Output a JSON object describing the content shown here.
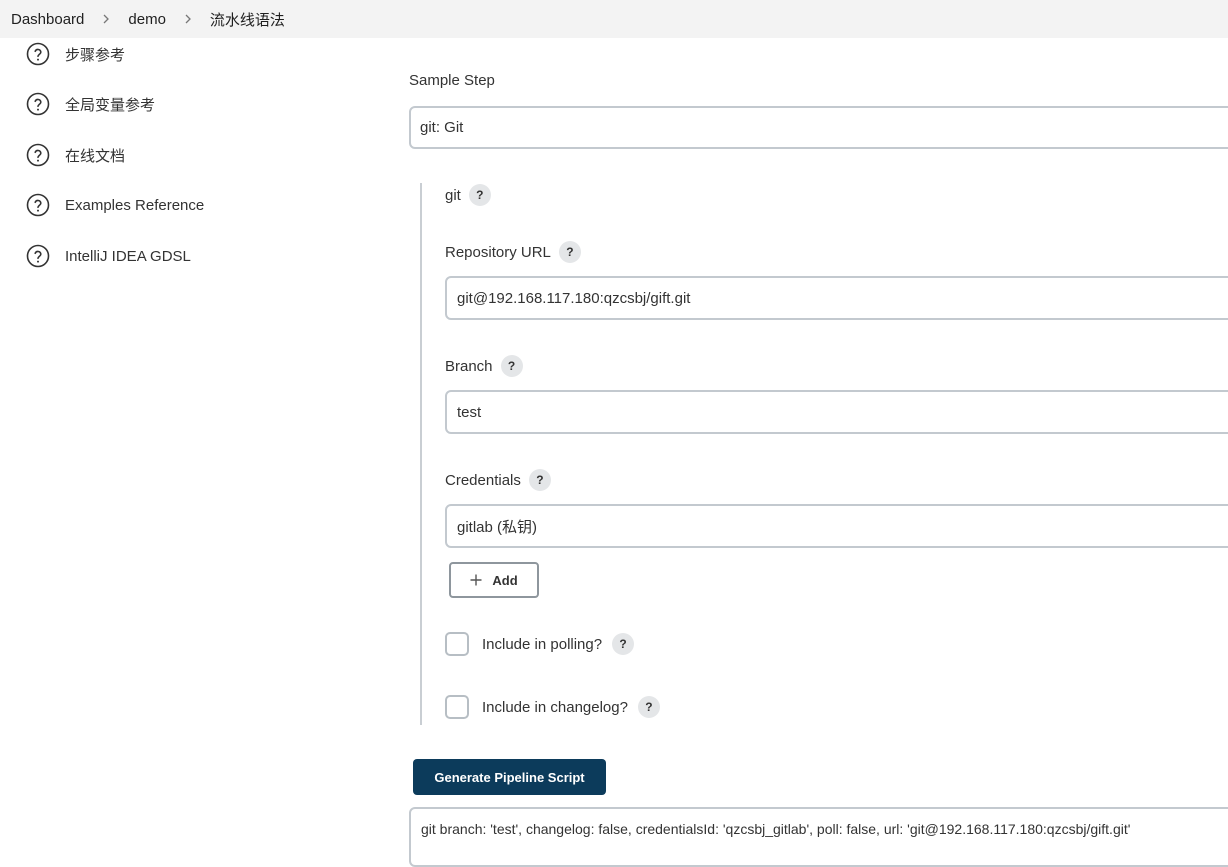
{
  "breadcrumb": {
    "items": [
      "Dashboard",
      "demo",
      "流水线语法"
    ]
  },
  "sidebar": {
    "items": [
      {
        "label": "步骤参考",
        "icon": "help-circle-icon"
      },
      {
        "label": "全局变量参考",
        "icon": "help-circle-icon"
      },
      {
        "label": "在线文档",
        "icon": "help-circle-icon"
      },
      {
        "label": "Examples Reference",
        "icon": "help-circle-icon"
      },
      {
        "label": "IntelliJ IDEA GDSL",
        "icon": "help-circle-icon"
      }
    ]
  },
  "form": {
    "sample_step_label": "Sample Step",
    "sample_step_value": "git: Git",
    "git_label": "git",
    "help_symbol": "?",
    "repo_url_label": "Repository URL",
    "repo_url_value": "git@192.168.117.180:qzcsbj/gift.git",
    "branch_label": "Branch",
    "branch_value": "test",
    "credentials_label": "Credentials",
    "credentials_value": "gitlab (私钥)",
    "add_label": "Add",
    "include_polling_label": "Include in polling?",
    "include_polling_checked": false,
    "include_changelog_label": "Include in changelog?",
    "include_changelog_checked": false
  },
  "generate": {
    "button_label": "Generate Pipeline Script",
    "output": "git branch: 'test', changelog: false, credentialsId: 'qzcsbj_gitlab', poll: false, url: 'git@192.168.117.180:qzcsbj/gift.git'"
  },
  "colors": {
    "primary_button": "#0c3b5b",
    "breadcrumb_bg": "#f3f3f3",
    "input_border": "#c3c9cf"
  }
}
